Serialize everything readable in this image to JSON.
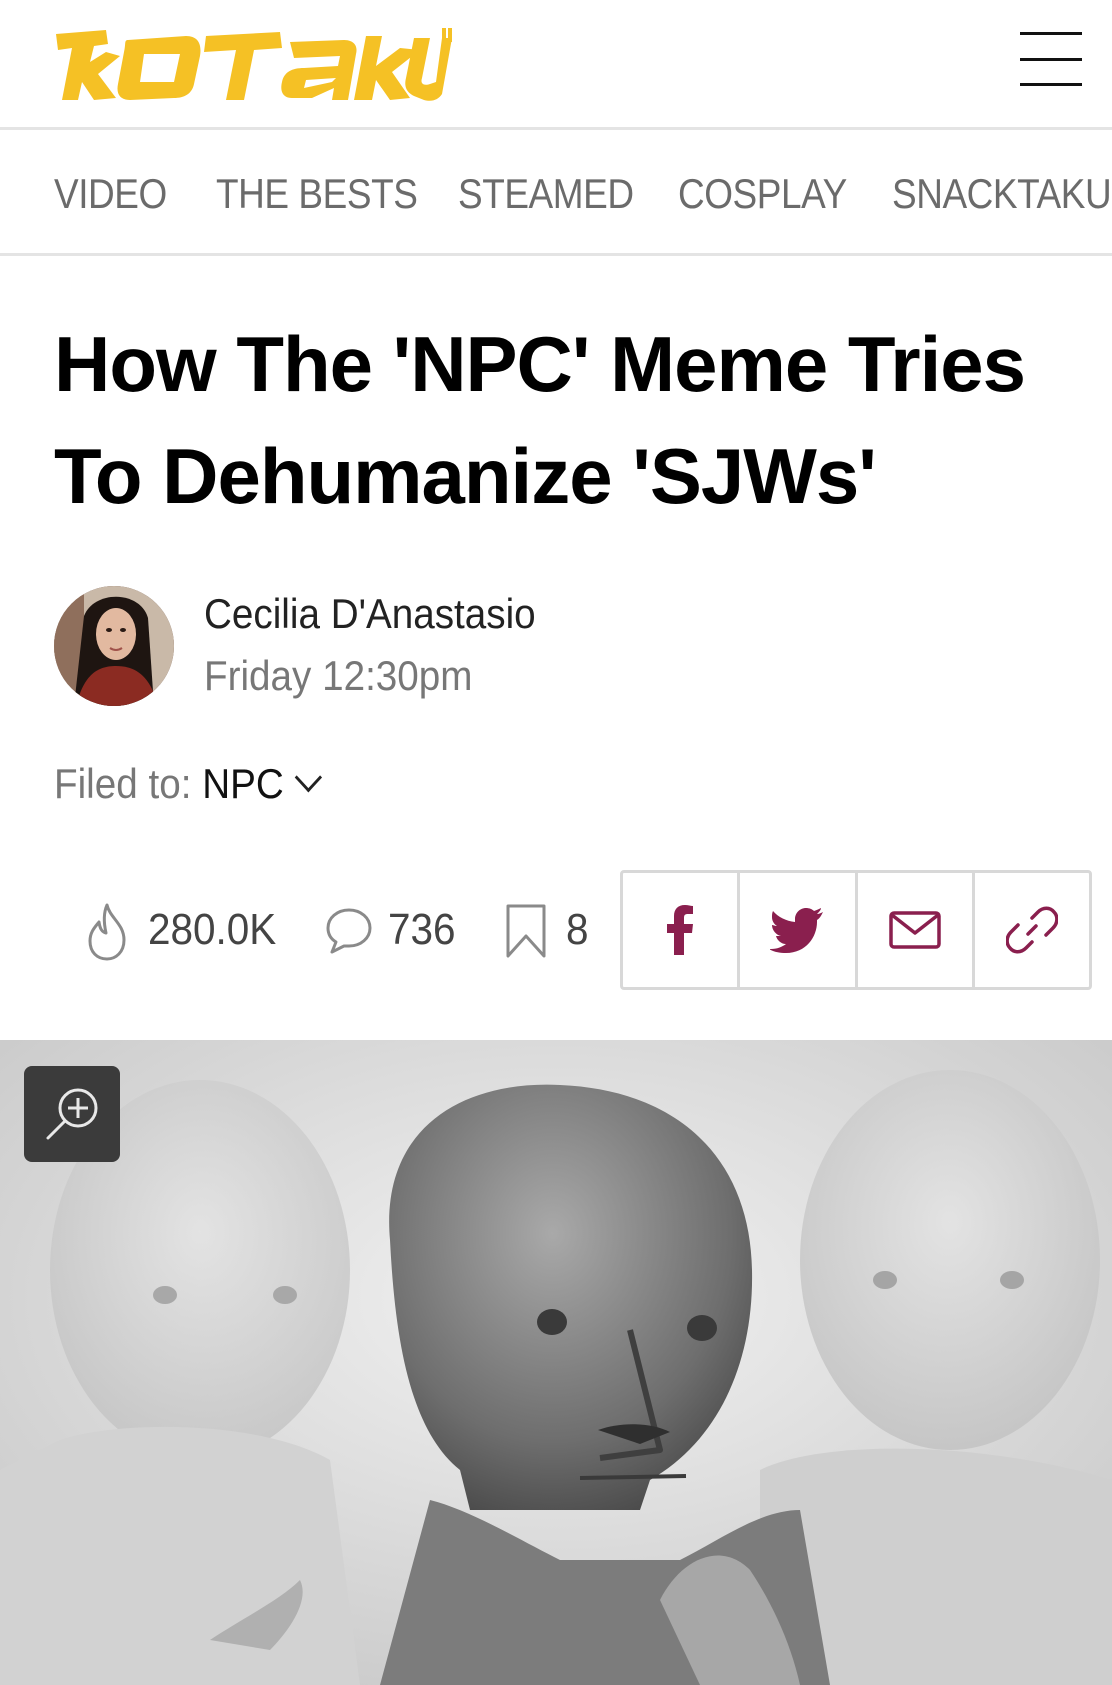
{
  "brand": {
    "logo_text": "KOTAKU",
    "accent": "#f5c125"
  },
  "nav": {
    "items": [
      {
        "label": "VIDEO"
      },
      {
        "label": "THE BESTS"
      },
      {
        "label": "STEAMED"
      },
      {
        "label": "COSPLAY"
      },
      {
        "label": "SNACKTAKU"
      }
    ]
  },
  "article": {
    "title": "How The 'NPC' Meme Tries To Dehumanize 'SJWs'",
    "author": "Cecilia D'Anastasio",
    "time": "Friday 12:30pm",
    "filed_label": "Filed to: ",
    "filed_tag": "NPC"
  },
  "stats": {
    "views": "280.0K",
    "comments": "736",
    "saves": "8"
  },
  "share": {
    "icon_color": "#8a1f4e",
    "buttons": [
      "facebook-icon",
      "twitter-icon",
      "mail-icon",
      "link-icon"
    ]
  },
  "icons": {
    "menu": "hamburger-icon",
    "zoom": "zoom-in-icon",
    "views": "flame-icon",
    "comments": "comment-bubble-icon",
    "saves": "bookmark-icon"
  }
}
